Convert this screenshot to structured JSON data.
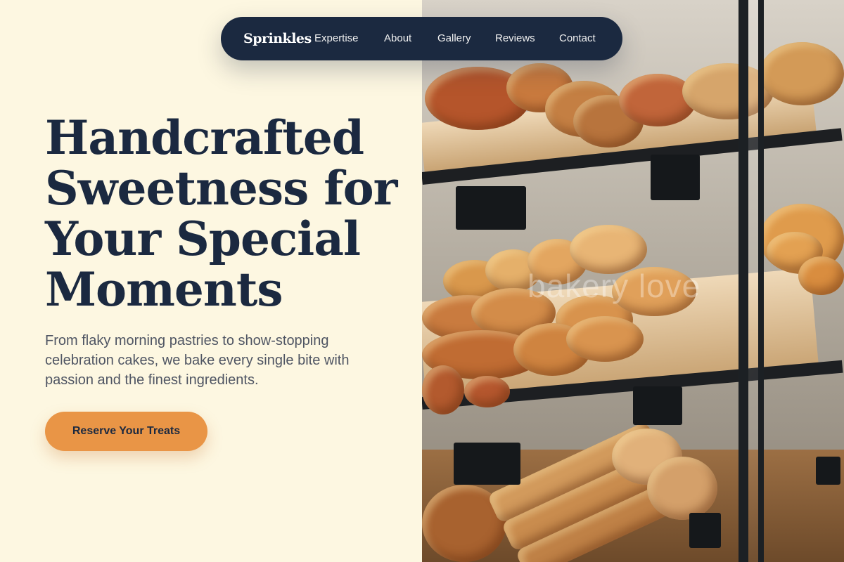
{
  "nav": {
    "brand": "Sprinkles",
    "links": [
      "Expertise",
      "About",
      "Gallery",
      "Reviews",
      "Contact"
    ]
  },
  "hero": {
    "title_lines": [
      "Handcrafted",
      "Sweetness for",
      "Your Special",
      "Moments"
    ],
    "subtitle_lines": [
      "From flaky morning pastries to show-stopping",
      "celebration cakes, we bake every single bite with",
      "passion and the finest ingredients."
    ],
    "cta_label": "Reserve Your Treats"
  },
  "image": {
    "description_icon": "bakery-display-photo",
    "watermark_text": "bakery love"
  },
  "colors": {
    "background": "#fdf7e1",
    "navy": "#1b2940",
    "accent": "#e99546",
    "body_text": "#4f5563"
  }
}
